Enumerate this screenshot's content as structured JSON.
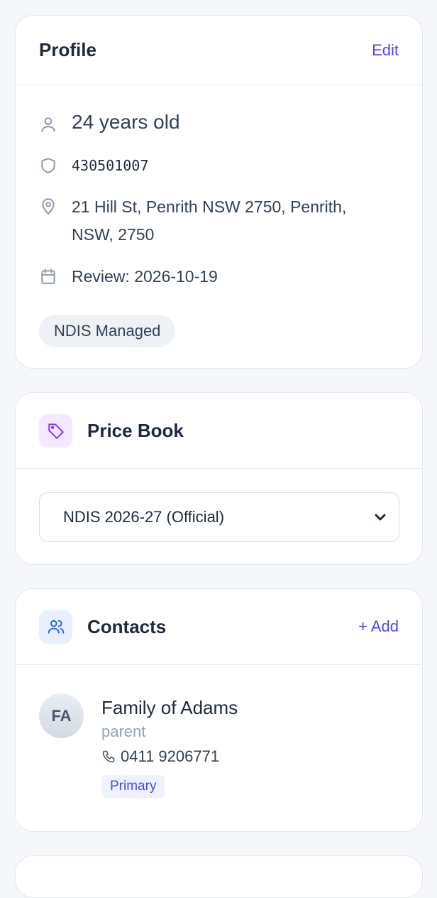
{
  "profile": {
    "title": "Profile",
    "edit_label": "Edit",
    "age": "24 years old",
    "ndis_number": "430501007",
    "address": "21 Hill St, Penrith NSW 2750, Penrith, NSW, 2750",
    "review": "Review: 2026-10-19",
    "plan_badge": "NDIS Managed"
  },
  "price_book": {
    "title": "Price Book",
    "selected": "NDIS 2026-27 (Official)"
  },
  "contacts": {
    "title": "Contacts",
    "add_label": "+ Add",
    "items": [
      {
        "initials": "FA",
        "name": "Family of Adams",
        "role": "parent",
        "phone": "0411 9206771",
        "badge": "Primary"
      }
    ]
  },
  "colors": {
    "accent": "#4f46e5",
    "text": "#1e293b",
    "muted": "#94a3b8",
    "border": "#e2e8f0"
  }
}
